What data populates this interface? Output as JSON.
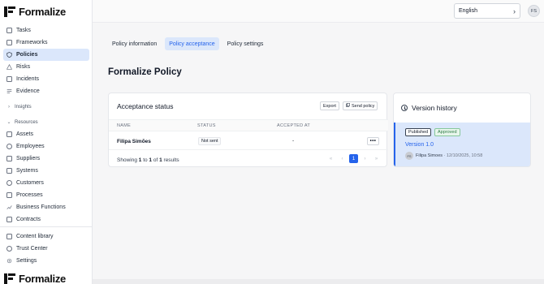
{
  "brand": {
    "name": "Formalize"
  },
  "sidebar": {
    "items": [
      {
        "label": "Tasks",
        "icon": "tasks-icon"
      },
      {
        "label": "Frameworks",
        "icon": "frameworks-icon"
      },
      {
        "label": "Policies",
        "icon": "shield-icon",
        "active": true
      },
      {
        "label": "Risks",
        "icon": "warning-icon"
      },
      {
        "label": "Incidents",
        "icon": "incident-icon"
      },
      {
        "label": "Evidence",
        "icon": "evidence-icon"
      }
    ],
    "insights_label": "Insights",
    "resources_label": "Resources",
    "resources": [
      {
        "label": "Assets",
        "icon": "assets-icon"
      },
      {
        "label": "Employees",
        "icon": "employees-icon"
      },
      {
        "label": "Suppliers",
        "icon": "suppliers-icon"
      },
      {
        "label": "Systems",
        "icon": "systems-icon"
      },
      {
        "label": "Customers",
        "icon": "customers-icon"
      },
      {
        "label": "Processes",
        "icon": "processes-icon"
      },
      {
        "label": "Business Functions",
        "icon": "business-functions-icon"
      },
      {
        "label": "Contracts",
        "icon": "contracts-icon"
      }
    ],
    "bottom": [
      {
        "label": "Content library",
        "icon": "library-icon"
      },
      {
        "label": "Trust Center",
        "icon": "trust-icon"
      },
      {
        "label": "Settings",
        "icon": "gear-icon"
      }
    ]
  },
  "topbar": {
    "language": "English",
    "avatar_initials": "FS"
  },
  "tabs": [
    {
      "label": "Policy information"
    },
    {
      "label": "Policy acceptance",
      "active": true
    },
    {
      "label": "Policy settings"
    }
  ],
  "page_title": "Formalize Policy",
  "acceptance": {
    "title": "Acceptance status",
    "export_label": "Export",
    "send_label": "Send policy",
    "columns": [
      "NAME",
      "STATUS",
      "ACCEPTED AT"
    ],
    "rows": [
      {
        "name": "Filipa Simões",
        "status": "Not sent",
        "accepted_at": "-"
      }
    ],
    "showing_prefix": "Showing",
    "showing_from": "1",
    "showing_to_word": "to",
    "showing_to": "1",
    "showing_of_word": "of",
    "showing_total": "1",
    "showing_suffix": "results",
    "current_page": "1"
  },
  "version_history": {
    "title": "Version history",
    "items": [
      {
        "status": "Published",
        "approval": "Approved",
        "version": "Version 1.0",
        "author_initials": "FS",
        "author": "Filipa Simoes",
        "timestamp": "12/10/2025, 10:58"
      }
    ]
  },
  "colors": {
    "accent": "#2563eb",
    "active_bg": "#dbe7fb",
    "approved": "#2f7d46"
  }
}
